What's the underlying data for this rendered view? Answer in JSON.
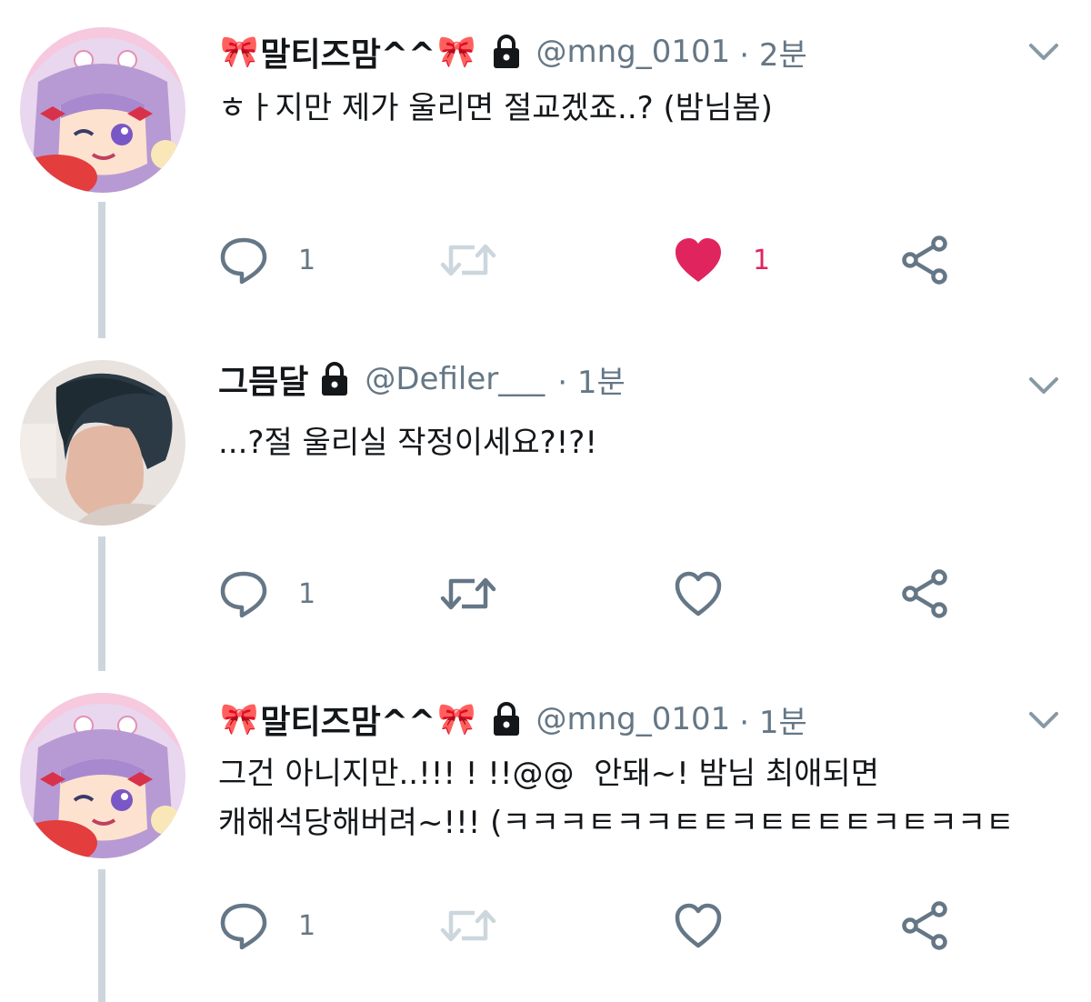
{
  "colors": {
    "icon_gray": "#657786",
    "like_red": "#e0245e",
    "thread_line": "#cdd6dd",
    "bow_pink": "#e9267e"
  },
  "tweets": [
    {
      "display_name": "말티즈맘^^",
      "bow_emoji": "🎀",
      "handle": "@mng_0101",
      "time": "· 2분",
      "text": "ㅎㅏ지만 제가 울리면 절교겠죠..? (밤님봄)",
      "reply_count": "1",
      "retweet_count": "",
      "like_count": "1",
      "liked": true,
      "protected": true
    },
    {
      "display_name": "그믐달",
      "bow_emoji": "",
      "handle": "@Defiler___",
      "time": "· 1분",
      "text": "...?절 울리실 작정이세요?!?!",
      "reply_count": "1",
      "retweet_count": "",
      "like_count": "",
      "liked": false,
      "protected": true
    },
    {
      "display_name": "말티즈맘^^",
      "bow_emoji": "🎀",
      "handle": "@mng_0101",
      "time": "· 1분",
      "text": "그건 아니지만..!!! ! !!@@  안돼~! 밤님 최애되면\n캐해석당해버려~!!! (ㅋㅋㅋㅌㅋㅋㅌㅌㅋㅌㅌㅌㅌㅋㅌㅋㅋㅌ",
      "reply_count": "1",
      "retweet_count": "",
      "like_count": "",
      "liked": false,
      "protected": true
    }
  ]
}
